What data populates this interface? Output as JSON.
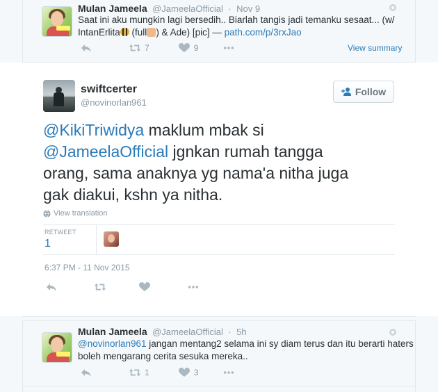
{
  "tweet1": {
    "name": "Mulan Jameela",
    "handle": "@JameelaOfficial",
    "time": "Nov 9",
    "text_a": "Saat ini aku mungkin lagi bersedih.. Biarlah tangis jadi temanku sesaat... (w/",
    "text_b1": "IntanErlita",
    "text_b2": " (full",
    "text_b3": ") & Ade) [pic] — ",
    "link": "path.com/p/3rxJao",
    "retweets": "7",
    "likes": "9",
    "view_summary": "View summary"
  },
  "main": {
    "name": "swiftcerter",
    "handle": "@novinorlan961",
    "follow_label": "Follow",
    "mention1": "@KikiTriwidya",
    "text1": " maklum mbak si",
    "mention2": "@JameelaOfficial",
    "text2": " jgnkan rumah tangga",
    "text3": "orang, sama anaknya yg nama'a nitha juga",
    "text4": "gak diakui, kshn ya nitha.",
    "view_translation": "View translation",
    "retweet_label": "RETWEET",
    "retweet_count": "1",
    "timestamp": "6:37 PM - 11 Nov 2015"
  },
  "reply": {
    "name": "Mulan Jameela",
    "handle": "@JameelaOfficial",
    "time": "5h",
    "mention": "@novinorlan961",
    "text1": " jangan mentang2 selama ini sy diam terus dan itu berarti haters",
    "text2": "boleh mengarang cerita sesuka mereka..",
    "retweets": "1",
    "likes": "3"
  },
  "colors": {
    "link": "#2b7bb9",
    "muted": "#8899a6",
    "border": "#e1e8ed",
    "band": "#f5f8fa"
  }
}
